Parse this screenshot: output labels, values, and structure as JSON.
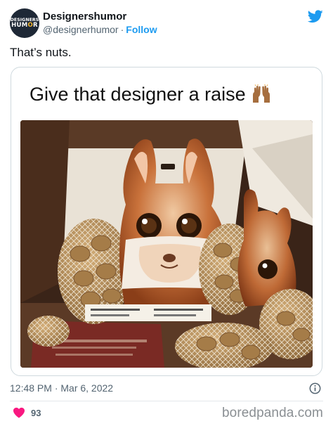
{
  "account": {
    "avatar_line1": "DESIGNERS",
    "avatar_line2_a": "HUM",
    "avatar_line2_b": "O",
    "avatar_line2_c": "R",
    "display_name": "Designershumor",
    "handle": "@designerhumor",
    "separator": "·",
    "follow_label": "Follow"
  },
  "tweet": {
    "text": "That’s nuts.",
    "timestamp": "12:48 PM · Mar 6, 2022"
  },
  "media": {
    "caption": "Give that designer a raise",
    "caption_emoji": "raising-hands-emoji"
  },
  "engagement": {
    "like_count": "93"
  },
  "watermark": "boredpanda.com",
  "colors": {
    "twitter_blue": "#1d9bf0",
    "like_red": "#f91880",
    "muted_text": "#536471"
  },
  "icons": [
    "twitter-bird-icon",
    "info-icon",
    "heart-icon"
  ]
}
